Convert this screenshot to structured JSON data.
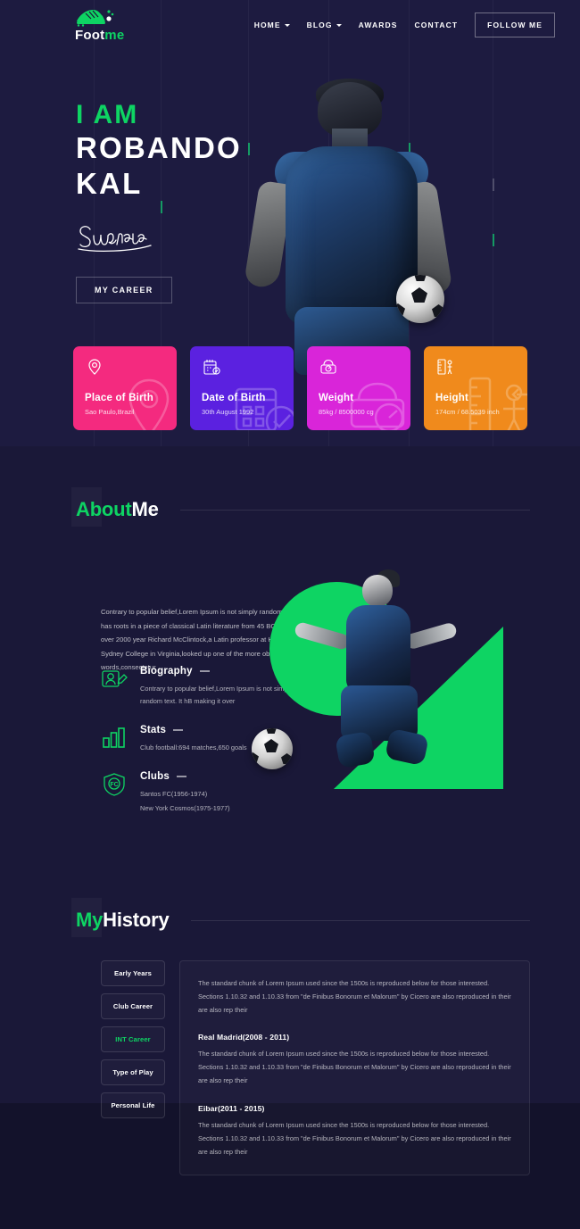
{
  "colors": {
    "bg": "#1a1838",
    "green": "#0ed463",
    "pink": "#f42a7f",
    "violet": "#5b21e0",
    "magenta": "#d925d9",
    "orange": "#f08a1c"
  },
  "nav": {
    "logo_word_white": "Foot",
    "logo_word_green": "me",
    "logo_icon": "football-boot-icon",
    "links": [
      {
        "label": "HOME",
        "caret": true
      },
      {
        "label": "BLOG",
        "caret": true
      },
      {
        "label": "AWARDS",
        "caret": false
      },
      {
        "label": "CONTACT",
        "caret": false
      }
    ],
    "cta": "FOLLOW ME"
  },
  "hero": {
    "eyebrow": "I AM",
    "name_line1": "ROBANDO",
    "name_line2": "KAL",
    "signature_alt": "Signature",
    "cta": "MY CAREER"
  },
  "info_cards": [
    {
      "title": "Place of Birth",
      "value": "Sao Paulo,Brazil",
      "icon": "map-pin-icon",
      "color": "#f42a7f"
    },
    {
      "title": "Date of Birth",
      "value": "30th August 1992",
      "icon": "calendar-icon",
      "color": "#5b21e0"
    },
    {
      "title": "Weight",
      "value": "85kg / 8500000 cg",
      "icon": "weight-scale-icon",
      "color": "#d925d9"
    },
    {
      "title": "Height",
      "value": "174cm / 68.5039 inch",
      "icon": "ruler-icon",
      "color": "#f08a1c"
    }
  ],
  "about": {
    "title_green": "About",
    "title_white": "Me",
    "paragraph": "Contrary to popular belief,Lorem Ipsum is not simply random text. It has roots in a piece of classical Latin literature from 45 BC,making it over 2000 year Richard McClintock,a Latin professor at Hampden-Sydney College in Virginia,looked up one of the more obscure Latin words,consectetur",
    "features": [
      {
        "heading": "Biography",
        "icon": "biography-icon",
        "lines": [
          "Contrary to popular belief,Lorem Ipsum is not simply random text. It hB making it over"
        ]
      },
      {
        "heading": "Stats",
        "icon": "bar-chart-icon",
        "lines": [
          "Club football:694 matches,650 goals"
        ]
      },
      {
        "heading": "Clubs",
        "icon": "club-badge-icon",
        "lines": [
          "Santos FC(1956-1974)",
          "New York Cosmos(1975-1977)"
        ]
      }
    ]
  },
  "history": {
    "title_green": "My",
    "title_white": "History",
    "tabs": [
      {
        "label": "Early Years",
        "active": false
      },
      {
        "label": "Club Career",
        "active": false
      },
      {
        "label": "INT Career",
        "active": true
      },
      {
        "label": "Type of Play",
        "active": false
      },
      {
        "label": "Personal Life",
        "active": false
      }
    ],
    "entries": [
      {
        "heading": "",
        "body": "The standard chunk of Lorem Ipsum used since the 1500s is reproduced below for those interested. Sections 1.10.32 and 1.10.33 from \"de Finibus Bonorum et Malorum\" by Cicero are also reproduced in their are also rep their"
      },
      {
        "heading": "Real Madrid(2008 - 2011)",
        "body": "The standard chunk of Lorem Ipsum used since the 1500s is reproduced below for those interested. Sections 1.10.32 and 1.10.33 from \"de Finibus Bonorum et Malorum\" by Cicero are also reproduced in their are also rep their"
      },
      {
        "heading": "Eibar(2011 - 2015)",
        "body": "The standard chunk of Lorem Ipsum used since the 1500s is reproduced below for those interested. Sections 1.10.32 and 1.10.33 from \"de Finibus Bonorum et Malorum\" by Cicero are also reproduced in their are also rep their"
      }
    ]
  }
}
